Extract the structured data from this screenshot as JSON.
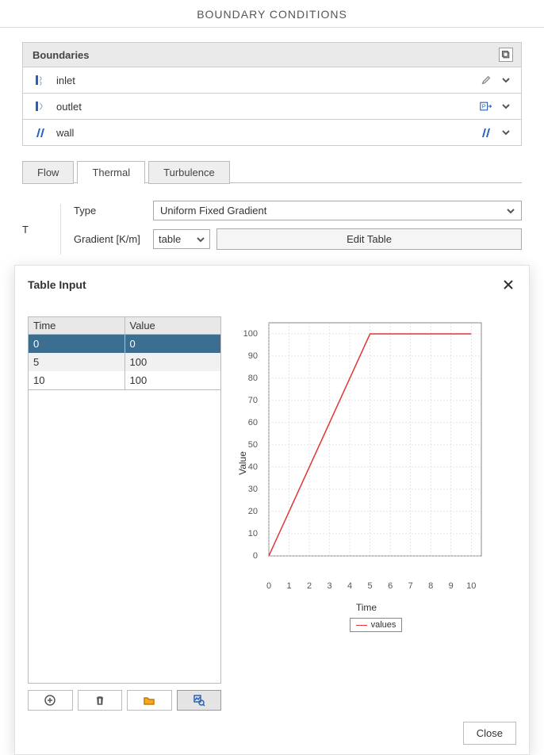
{
  "page_title": "BOUNDARY CONDITIONS",
  "boundaries_header": "Boundaries",
  "boundaries": [
    {
      "name": "inlet",
      "icon": "inlet-icon",
      "type_icon": "pencil-icon"
    },
    {
      "name": "outlet",
      "icon": "outlet-icon",
      "type_icon": "pressure-icon"
    },
    {
      "name": "wall",
      "icon": "wall-icon",
      "type_icon": "wall-bc-icon"
    }
  ],
  "tabs": {
    "flow": "Flow",
    "thermal": "Thermal",
    "turbulence": "Turbulence"
  },
  "thermal": {
    "field": "T",
    "type_label": "Type",
    "type_value": "Uniform Fixed Gradient",
    "gradient_label": "Gradient [K/m]",
    "gradient_mode": "table",
    "edit_button": "Edit Table"
  },
  "modal": {
    "title": "Table Input",
    "col_time": "Time",
    "col_value": "Value",
    "rows": [
      {
        "time": "0",
        "value": "0"
      },
      {
        "time": "5",
        "value": "100"
      },
      {
        "time": "10",
        "value": "100"
      }
    ],
    "legend": "values",
    "close": "Close",
    "xlabel": "Time",
    "ylabel": "Value"
  },
  "chart_data": {
    "type": "line",
    "x": [
      0,
      5,
      10
    ],
    "series": [
      {
        "name": "values",
        "values": [
          0,
          100,
          100
        ],
        "color": "#e33333"
      }
    ],
    "title": "",
    "xlabel": "Time",
    "ylabel": "Value",
    "xlim": [
      0,
      10.5
    ],
    "ylim": [
      0,
      105
    ],
    "xticks": [
      0,
      1,
      2,
      3,
      4,
      5,
      6,
      7,
      8,
      9,
      10
    ],
    "yticks": [
      0,
      10,
      20,
      30,
      40,
      50,
      60,
      70,
      80,
      90,
      100
    ]
  }
}
